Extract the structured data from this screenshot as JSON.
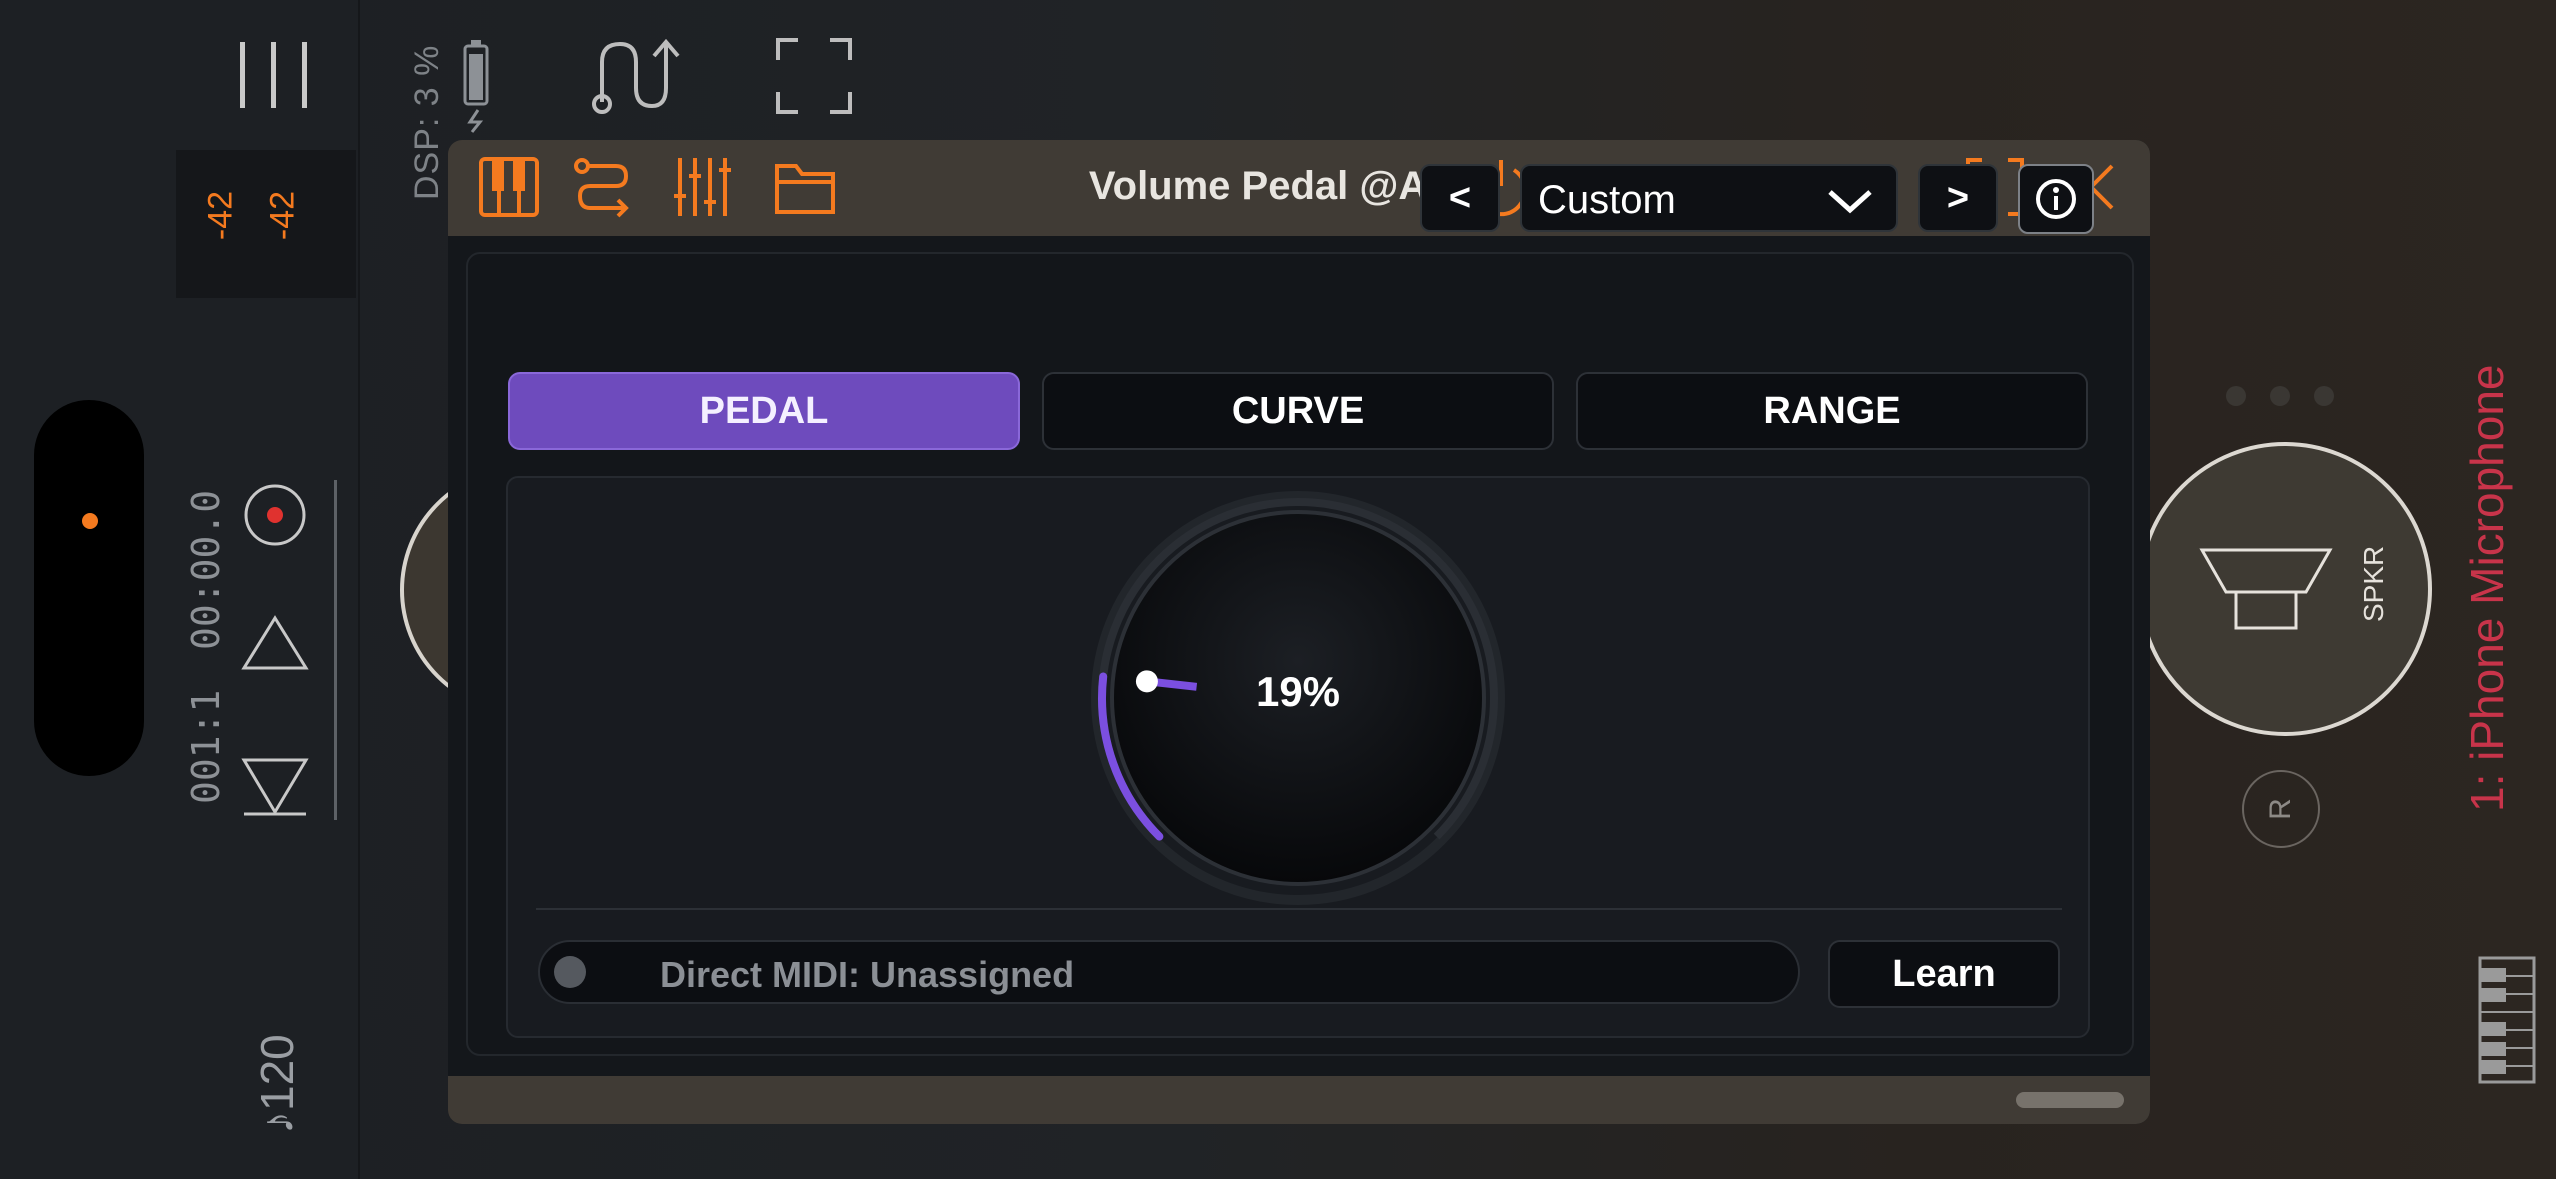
{
  "sidebar": {
    "meter_left": "-42",
    "meter_right": "-42",
    "time_position": "00:00.0",
    "bar_position": "001:1",
    "tempo": "♪120"
  },
  "top": {
    "dsp_label": "DSP: 3 %"
  },
  "plugin": {
    "title": "Volume Pedal @A1:1",
    "prev_label": "<",
    "next_label": ">",
    "preset_value": "Custom",
    "tabs": [
      {
        "label": "PEDAL",
        "active": true
      },
      {
        "label": "CURVE",
        "active": false
      },
      {
        "label": "RANGE",
        "active": false
      }
    ],
    "knob_value_text": "19%",
    "knob_fraction": 0.19,
    "midi_label": "Direct MIDI: Unassigned",
    "learn_label": "Learn"
  },
  "right": {
    "speaker_label": "SPKR",
    "r_label": "R",
    "input_label": "1: iPhone Microphone"
  },
  "colors": {
    "accent_orange": "#f47a1f",
    "accent_purple": "#6e4bbd",
    "record_red": "#e0322f",
    "input_red": "#c8344a"
  }
}
